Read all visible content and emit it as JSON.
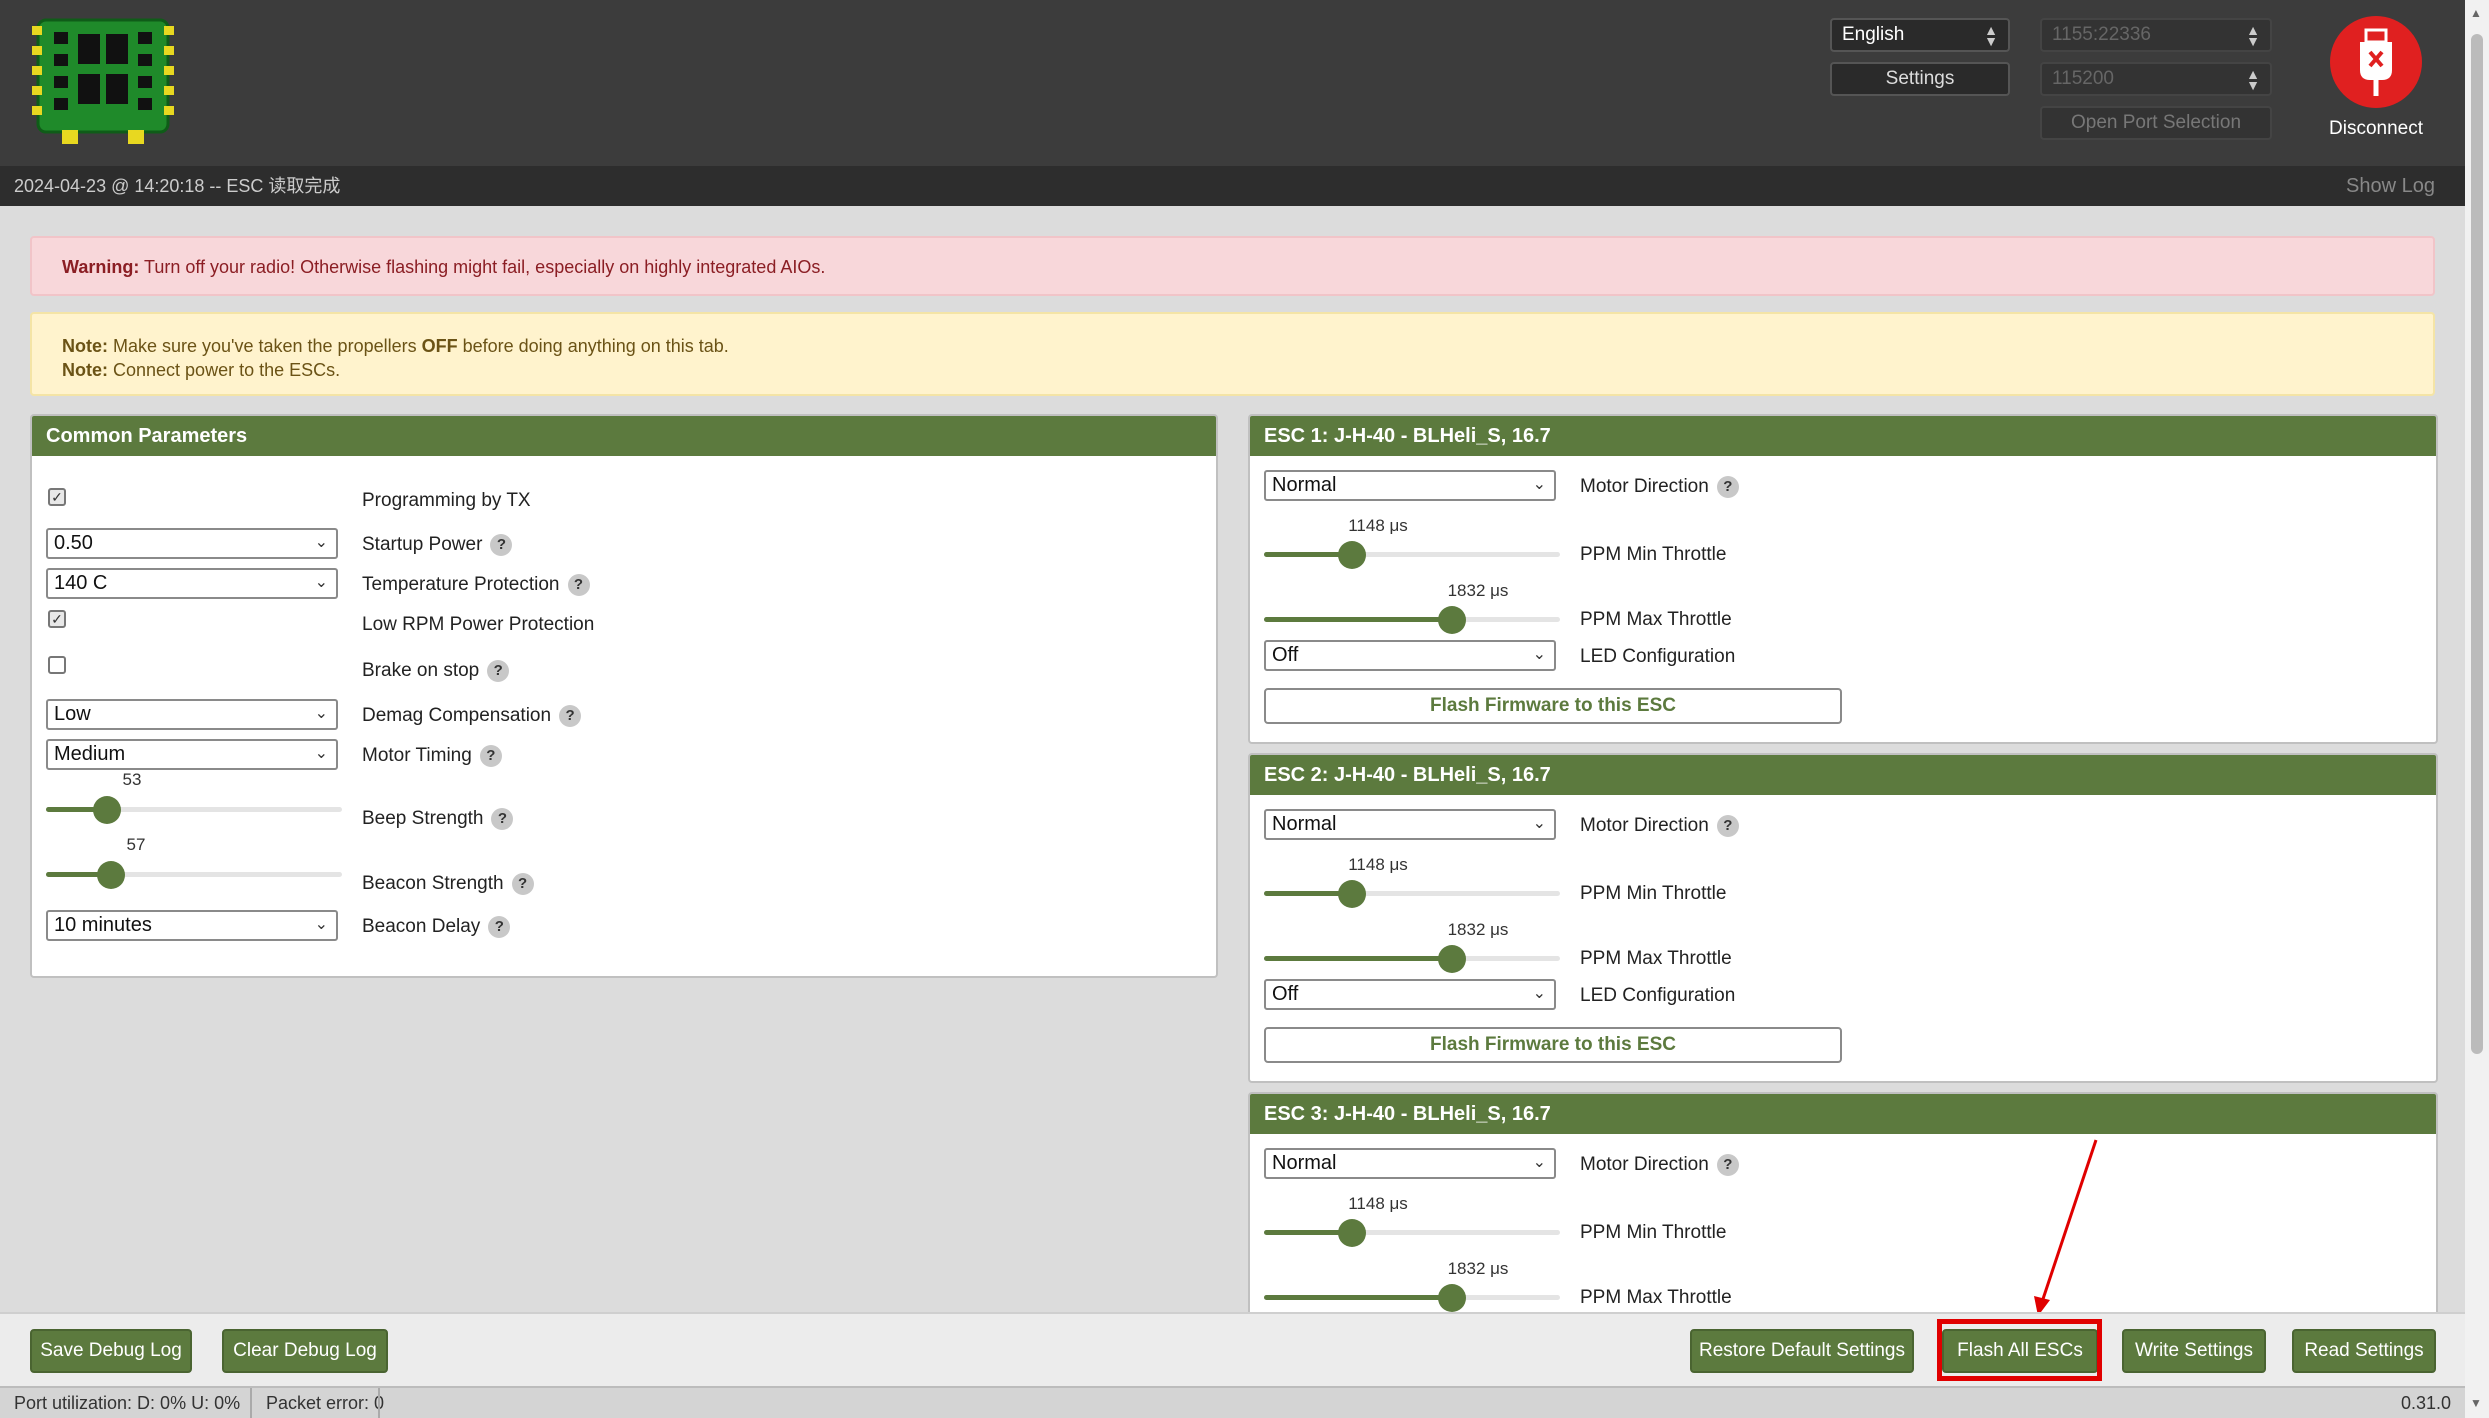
{
  "header": {
    "language": "English",
    "settings_label": "Settings",
    "port": "1155:22336",
    "baud": "115200",
    "open_port_label": "Open Port Selection",
    "disconnect_label": "Disconnect"
  },
  "logbar": {
    "message": "2024-04-23 @ 14:20:18 -- ESC 读取完成",
    "show_log": "Show Log"
  },
  "alerts": {
    "warning_bold": "Warning:",
    "warning_text": " Turn off your radio! Otherwise flashing might fail, especially on highly integrated AIOs.",
    "note_bold": "Note:",
    "note1_a": " Make sure you've taken the propellers ",
    "note1_b": "OFF",
    "note1_c": " before doing anything on this tab.",
    "note2_text": " Connect power to the ESCs."
  },
  "common": {
    "title": "Common Parameters",
    "programming_by_tx": {
      "label": "Programming by TX",
      "checked": true
    },
    "startup_power": {
      "label": "Startup Power",
      "value": "0.50"
    },
    "temperature_protection": {
      "label": "Temperature Protection",
      "value": "140 C"
    },
    "low_rpm": {
      "label": "Low RPM Power Protection",
      "checked": true
    },
    "brake_on_stop": {
      "label": "Brake on stop",
      "checked": false
    },
    "demag": {
      "label": "Demag Compensation",
      "value": "Low"
    },
    "motor_timing": {
      "label": "Motor Timing",
      "value": "Medium"
    },
    "beep_strength": {
      "label": "Beep Strength",
      "value": "53"
    },
    "beacon_strength": {
      "label": "Beacon Strength",
      "value": "57"
    },
    "beacon_delay": {
      "label": "Beacon Delay",
      "value": "10 minutes"
    }
  },
  "esc_labels": {
    "motor_direction": "Motor Direction",
    "ppm_min": "PPM Min Throttle",
    "ppm_max": "PPM Max Throttle",
    "led": "LED Configuration",
    "flash": "Flash Firmware to this ESC"
  },
  "escs": [
    {
      "title": "ESC 1: J-H-40 - BLHeli_S, 16.7",
      "direction": "Normal",
      "ppm_min": "1148 μs",
      "ppm_max": "1832 μs",
      "led": "Off"
    },
    {
      "title": "ESC 2: J-H-40 - BLHeli_S, 16.7",
      "direction": "Normal",
      "ppm_min": "1148 μs",
      "ppm_max": "1832 μs",
      "led": "Off"
    },
    {
      "title": "ESC 3: J-H-40 - BLHeli_S, 16.7",
      "direction": "Normal",
      "ppm_min": "1148 μs",
      "ppm_max": "1832 μs"
    }
  ],
  "footer": {
    "save_debug": "Save Debug Log",
    "clear_debug": "Clear Debug Log",
    "restore": "Restore Default Settings",
    "flash_all": "Flash All ESCs",
    "write": "Write Settings",
    "read": "Read Settings"
  },
  "status": {
    "port_util": "Port utilization: D: 0% U: 0%",
    "packet_error": "Packet error: 0",
    "version": "0.31.0"
  },
  "colors": {
    "accent": "#5c7a3e",
    "highlight": "#e00000",
    "annotation_arrow": "#e00000"
  }
}
